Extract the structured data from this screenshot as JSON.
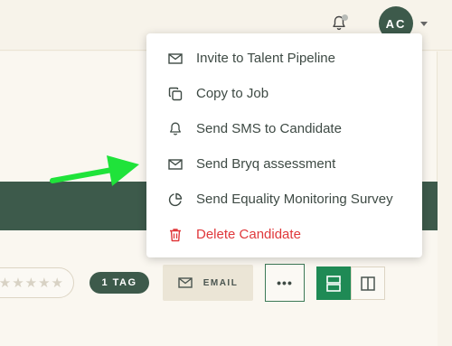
{
  "header": {
    "avatar_initials": "AC",
    "notification_icon": "bell-icon",
    "user_menu_icon": "caret-down-icon"
  },
  "menu": {
    "items": [
      {
        "label": "Invite to Talent Pipeline",
        "icon": "mail-icon"
      },
      {
        "label": "Copy to Job",
        "icon": "copy-icon"
      },
      {
        "label": "Send SMS to Candidate",
        "icon": "bell-icon"
      },
      {
        "label": "Send Bryq assessment",
        "icon": "mail-icon"
      },
      {
        "label": "Send Equality Monitoring Survey",
        "icon": "pie-chart-icon"
      },
      {
        "label": "Delete Candidate",
        "icon": "trash-icon",
        "danger": true
      }
    ]
  },
  "toolbar": {
    "rating_stars": "★★★★★",
    "tag_label": "1 TAG",
    "email_label": "EMAIL",
    "more_label": "•••"
  },
  "colors": {
    "brand_green": "#3d5a4b",
    "accent_green": "#1f8a55",
    "danger_red": "#e0383b",
    "arrow_green": "#1fe33a"
  }
}
